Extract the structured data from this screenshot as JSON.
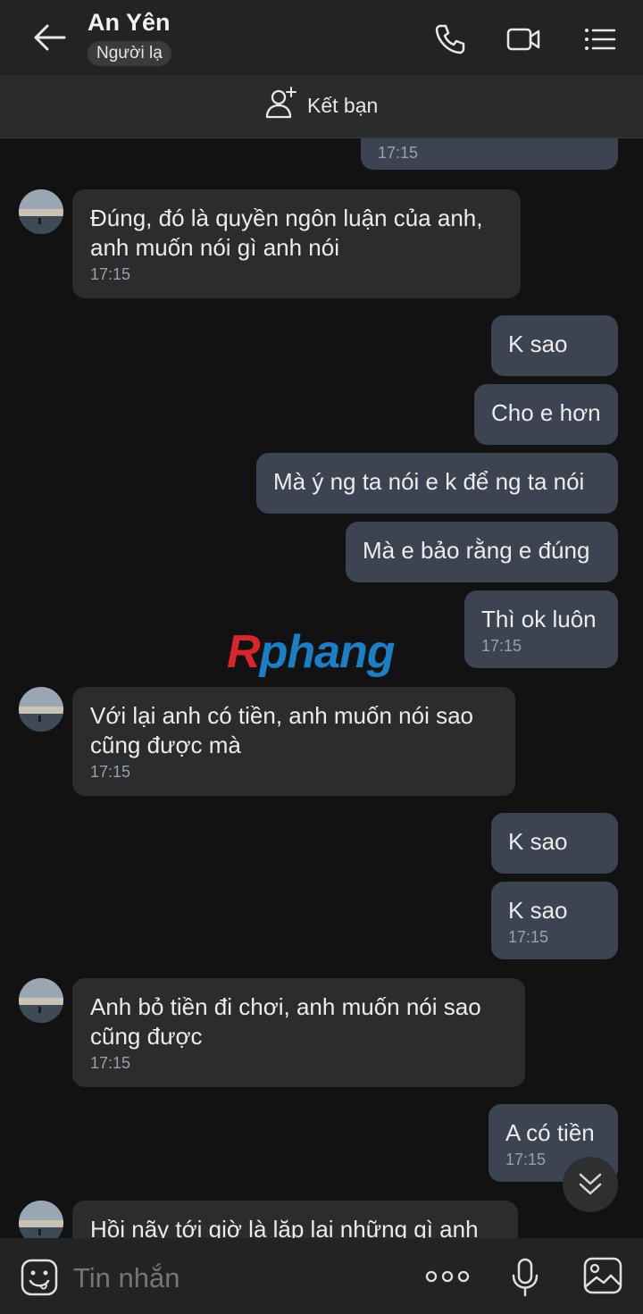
{
  "header": {
    "title": "An Yên",
    "stranger_badge": "Người lạ",
    "add_friend": "Kết bạn"
  },
  "messages": [
    {
      "side": "out",
      "text": "",
      "time": "17:15"
    },
    {
      "side": "in",
      "text": "Đúng, đó là quyền ngôn luận của anh, anh muốn nói gì anh nói",
      "time": "17:15"
    },
    {
      "side": "out",
      "text": "K sao",
      "time": ""
    },
    {
      "side": "out",
      "text": "Cho e hơn",
      "time": ""
    },
    {
      "side": "out",
      "text": "Mà ý ng ta nói e k để ng ta nói",
      "time": ""
    },
    {
      "side": "out",
      "text": "Mà e bảo rằng e đúng",
      "time": ""
    },
    {
      "side": "out",
      "text": "Thì ok luôn",
      "time": "17:15"
    },
    {
      "side": "in",
      "text": "Với lại anh có tiền, anh muốn nói sao cũng được mà",
      "time": "17:15"
    },
    {
      "side": "out",
      "text": "K sao",
      "time": ""
    },
    {
      "side": "out",
      "text": "K sao",
      "time": "17:15"
    },
    {
      "side": "in",
      "text": "Anh bỏ tiền đi chơi, anh muốn nói sao cũng được",
      "time": "17:15"
    },
    {
      "side": "out",
      "text": "A có tiền",
      "time": "17:15"
    },
    {
      "side": "in",
      "text": "Hồi nãy tới giờ là lặp lại những gì anh",
      "time": ""
    }
  ],
  "watermark": {
    "r": "R",
    "rest": "phang"
  },
  "input": {
    "placeholder": "Tin nhắn"
  },
  "icons": [
    "back-arrow-icon",
    "phone-icon",
    "video-icon",
    "menu-list-icon",
    "add-user-icon",
    "sticker-icon",
    "more-dots-icon",
    "mic-icon",
    "image-icon",
    "chevron-down-icon"
  ]
}
